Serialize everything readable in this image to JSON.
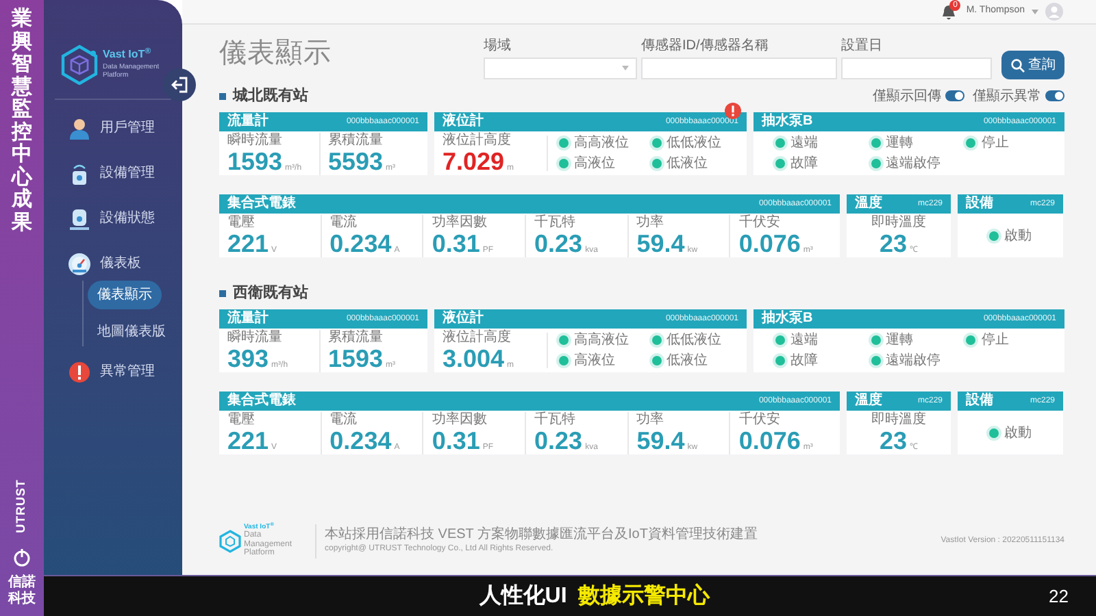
{
  "slide": {
    "side_title": "業興智慧監控中心成果",
    "brand": "UTRUST",
    "company": "信諾科技",
    "caption": "人性化UI",
    "caption_highlight": "數據示警中心",
    "page_number": "22"
  },
  "sidebar": {
    "logo_title": "Vast IoT",
    "logo_mark": "®",
    "logo_subtitle": "Data Management Platform",
    "items": [
      {
        "label": "用戶管理",
        "kind": "user",
        "selected": false
      },
      {
        "label": "設備管理",
        "kind": "device",
        "selected": false
      },
      {
        "label": "設備狀態",
        "kind": "status",
        "selected": false
      },
      {
        "label": "儀表板",
        "kind": "dashboard",
        "selected": false,
        "children": [
          {
            "label": "儀表顯示",
            "selected": true
          },
          {
            "label": "地圖儀表版",
            "selected": false
          }
        ]
      },
      {
        "label": "異常管理",
        "kind": "alert",
        "selected": false
      }
    ]
  },
  "topbar": {
    "notification_count": "0",
    "user": "M. Thompson"
  },
  "page_title": "儀表顯示",
  "filters": [
    {
      "label": "場域",
      "kind": "select"
    },
    {
      "label": "傳感器ID/傳感器名稱",
      "kind": "text"
    },
    {
      "label": "設置日",
      "kind": "text"
    }
  ],
  "search_button": "查詢",
  "toggles": [
    {
      "label": "僅顯示回傳",
      "on": true
    },
    {
      "label": "僅顯示異常",
      "on": true
    }
  ],
  "stations": [
    {
      "name": "城北既有站",
      "upper_cards": [
        {
          "title": "流量計",
          "device_id": "000bbbaaac000001",
          "alert": false,
          "metrics": [
            {
              "label": "瞬時流量",
              "value": "1593",
              "unit": "m³/h"
            },
            {
              "label": "累積流量",
              "value": "5593",
              "unit": "m³"
            }
          ]
        },
        {
          "title": "液位計",
          "device_id": "000bbbaaac000001",
          "alert": true,
          "metrics": [
            {
              "label": "液位計高度",
              "value": "7.029",
              "unit": "m"
            }
          ],
          "indicators": [
            {
              "label": "高高液位",
              "on": true
            },
            {
              "label": "低低液位",
              "on": true
            },
            {
              "label": "高液位",
              "on": true
            },
            {
              "label": "低液位",
              "on": true
            }
          ]
        },
        {
          "title": "抽水泵B",
          "device_id": "000bbbaaac000001",
          "alert": false,
          "indicators": [
            {
              "label": "遠端",
              "on": true
            },
            {
              "label": "運轉",
              "on": true
            },
            {
              "label": "停止",
              "on": true
            },
            {
              "label": "故障",
              "on": true
            },
            {
              "label": "遠端啟停",
              "on": true
            }
          ]
        }
      ],
      "lower_cards": [
        {
          "title": "集合式電錶",
          "device_id": "000bbbaaac000001",
          "alert": false,
          "metrics": [
            {
              "label": "電壓",
              "value": "221",
              "unit": "V"
            },
            {
              "label": "電流",
              "value": "0.234",
              "unit": "A"
            },
            {
              "label": "功率因數",
              "value": "0.31",
              "unit": "PF"
            },
            {
              "label": "千瓦特",
              "value": "0.23",
              "unit": "kva"
            },
            {
              "label": "功率",
              "value": "59.4",
              "unit": "kw"
            },
            {
              "label": "千伏安",
              "value": "0.076",
              "unit": "m³"
            }
          ]
        },
        {
          "title": "溫度",
          "device_id": "mc229",
          "alert": false,
          "metrics": [
            {
              "label": "即時溫度",
              "value": "23",
              "unit": "℃"
            }
          ]
        },
        {
          "title": "設備",
          "device_id": "mc229",
          "alert": false,
          "indicators": [
            {
              "label": "啟動",
              "on": true
            }
          ]
        }
      ]
    },
    {
      "name": "西衛既有站",
      "upper_cards": [
        {
          "title": "流量計",
          "device_id": "000bbbaaac000001",
          "alert": false,
          "metrics": [
            {
              "label": "瞬時流量",
              "value": "393",
              "unit": "m³/h"
            },
            {
              "label": "累積流量",
              "value": "1593",
              "unit": "m³"
            }
          ]
        },
        {
          "title": "液位計",
          "device_id": "000bbbaaac000001",
          "alert": false,
          "metrics": [
            {
              "label": "液位計高度",
              "value": "3.004",
              "unit": "m"
            }
          ],
          "indicators": [
            {
              "label": "高高液位",
              "on": true
            },
            {
              "label": "低低液位",
              "on": true
            },
            {
              "label": "高液位",
              "on": true
            },
            {
              "label": "低液位",
              "on": true
            }
          ]
        },
        {
          "title": "抽水泵B",
          "device_id": "000bbbaaac000001",
          "alert": false,
          "indicators": [
            {
              "label": "遠端",
              "on": true
            },
            {
              "label": "運轉",
              "on": true
            },
            {
              "label": "停止",
              "on": true
            },
            {
              "label": "故障",
              "on": true
            },
            {
              "label": "遠端啟停",
              "on": true
            }
          ]
        }
      ],
      "lower_cards": [
        {
          "title": "集合式電錶",
          "device_id": "000bbbaaac000001",
          "alert": false,
          "metrics": [
            {
              "label": "電壓",
              "value": "221",
              "unit": "V"
            },
            {
              "label": "電流",
              "value": "0.234",
              "unit": "A"
            },
            {
              "label": "功率因數",
              "value": "0.31",
              "unit": "PF"
            },
            {
              "label": "千瓦特",
              "value": "0.23",
              "unit": "kva"
            },
            {
              "label": "功率",
              "value": "59.4",
              "unit": "kw"
            },
            {
              "label": "千伏安",
              "value": "0.076",
              "unit": "m³"
            }
          ]
        },
        {
          "title": "溫度",
          "device_id": "mc229",
          "alert": false,
          "metrics": [
            {
              "label": "即時溫度",
              "value": "23",
              "unit": "℃"
            }
          ]
        },
        {
          "title": "設備",
          "device_id": "mc229",
          "alert": false,
          "indicators": [
            {
              "label": "啟動",
              "on": true
            }
          ]
        }
      ]
    }
  ],
  "footer": {
    "logo_title": "Vast IoT",
    "logo_mark": "®",
    "logo_subtitle": "Data Management Platform",
    "notice": "本站採用信諾科技 VEST 方案物聯數據匯流平台及IoT資料管理技術建置",
    "copyright": "copyright@ UTRUST Technology Co., Ltd All Rights Reserved.",
    "version": "VastIot Version : 20220511151134"
  }
}
